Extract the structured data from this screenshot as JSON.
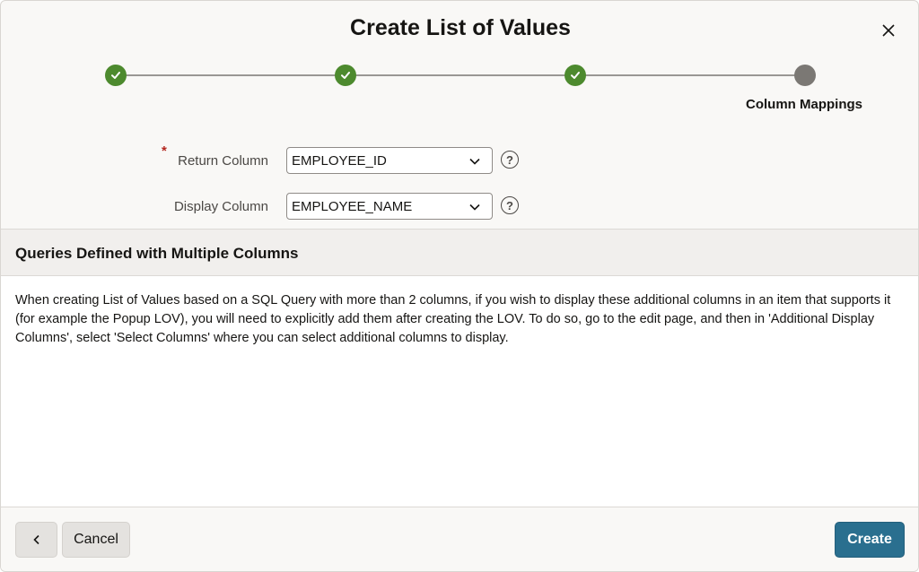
{
  "dialog": {
    "title": "Create List of Values",
    "close_icon": "close-icon"
  },
  "wizard": {
    "steps": [
      {
        "status": "complete",
        "icon": "check-icon"
      },
      {
        "status": "complete",
        "icon": "check-icon"
      },
      {
        "status": "complete",
        "icon": "check-icon"
      },
      {
        "status": "current",
        "label": "Column Mappings"
      }
    ],
    "colors": {
      "complete": "#4d8a2e",
      "current": "#7b7874"
    }
  },
  "form": {
    "return_column": {
      "label": "Return Column",
      "required_marker": "*",
      "value": "EMPLOYEE_ID"
    },
    "display_column": {
      "label": "Display Column",
      "value": "EMPLOYEE_NAME"
    },
    "help_glyph": "?"
  },
  "region": {
    "title": "Queries Defined with Multiple Columns",
    "body": "When creating List of Values based on a SQL Query with more than 2 columns, if you wish to display these additional columns in an item that supports it (for example the Popup LOV), you will need to explicitly add them after creating the LOV. To do so, go to the edit page, and then in 'Additional Display Columns', select 'Select Columns' where you can select additional columns to display."
  },
  "footer": {
    "back_icon": "chevron-left-icon",
    "cancel_label": "Cancel",
    "create_label": "Create",
    "create_color": "#2a6f8f"
  }
}
